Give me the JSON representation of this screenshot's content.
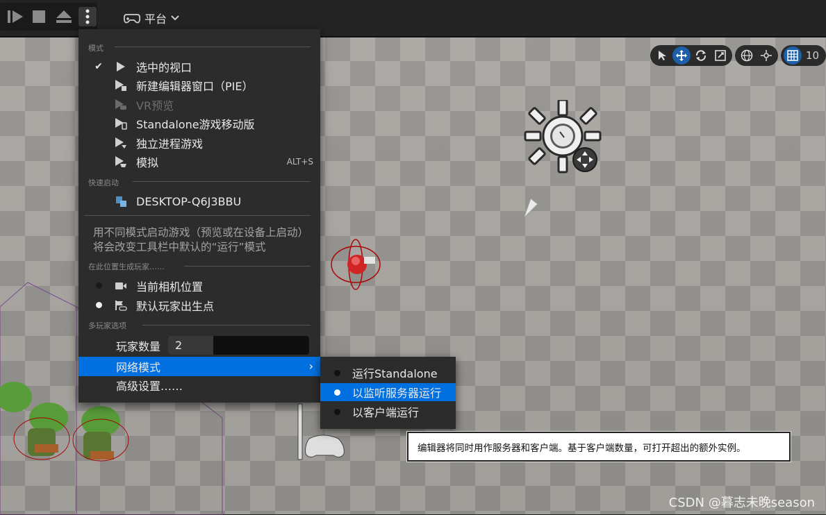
{
  "toolbar": {
    "platform_label": "平台"
  },
  "viewport_tools": {
    "grid_value": "10"
  },
  "menu": {
    "sections": {
      "mode": "模式",
      "quick_launch": "快速启动",
      "spawn_at": "在此位置生成玩家……",
      "multiplayer": "多玩家选项"
    },
    "mode_items": [
      {
        "label": "选中的视口",
        "checked": true
      },
      {
        "label": "新建编辑器窗口（PIE）"
      },
      {
        "label": "VR预览",
        "disabled": true
      },
      {
        "label": "Standalone游戏移动版"
      },
      {
        "label": "独立进程游戏"
      },
      {
        "label": "模拟",
        "shortcut": "ALT+S"
      }
    ],
    "quick_launch_item": "DESKTOP-Q6J3BBU",
    "description": "用不同模式启动游戏（预览或在设备上启动）将会改变工具栏中默认的“运行”模式",
    "spawn_items": [
      {
        "label": "当前相机位置",
        "selected": false
      },
      {
        "label": "默认玩家出生点",
        "selected": true
      }
    ],
    "player_count_label": "玩家数量",
    "player_count_value": "2",
    "player_count_fill": 0.32,
    "net_mode_label": "网络模式",
    "advanced_label": "高级设置……"
  },
  "submenu": {
    "items": [
      {
        "label": "运行Standalone",
        "selected": false
      },
      {
        "label": "以监听服务器运行",
        "selected": true
      },
      {
        "label": "以客户端运行",
        "selected": false
      }
    ]
  },
  "tooltip": "编辑器将同时用作服务器和客户端。基于客户端数量，可打开超出的额外实例。",
  "watermark": "CSDN @暮志未晚season",
  "colors": {
    "highlight": "#0070e0",
    "menu_bg": "#2c2c2c"
  }
}
